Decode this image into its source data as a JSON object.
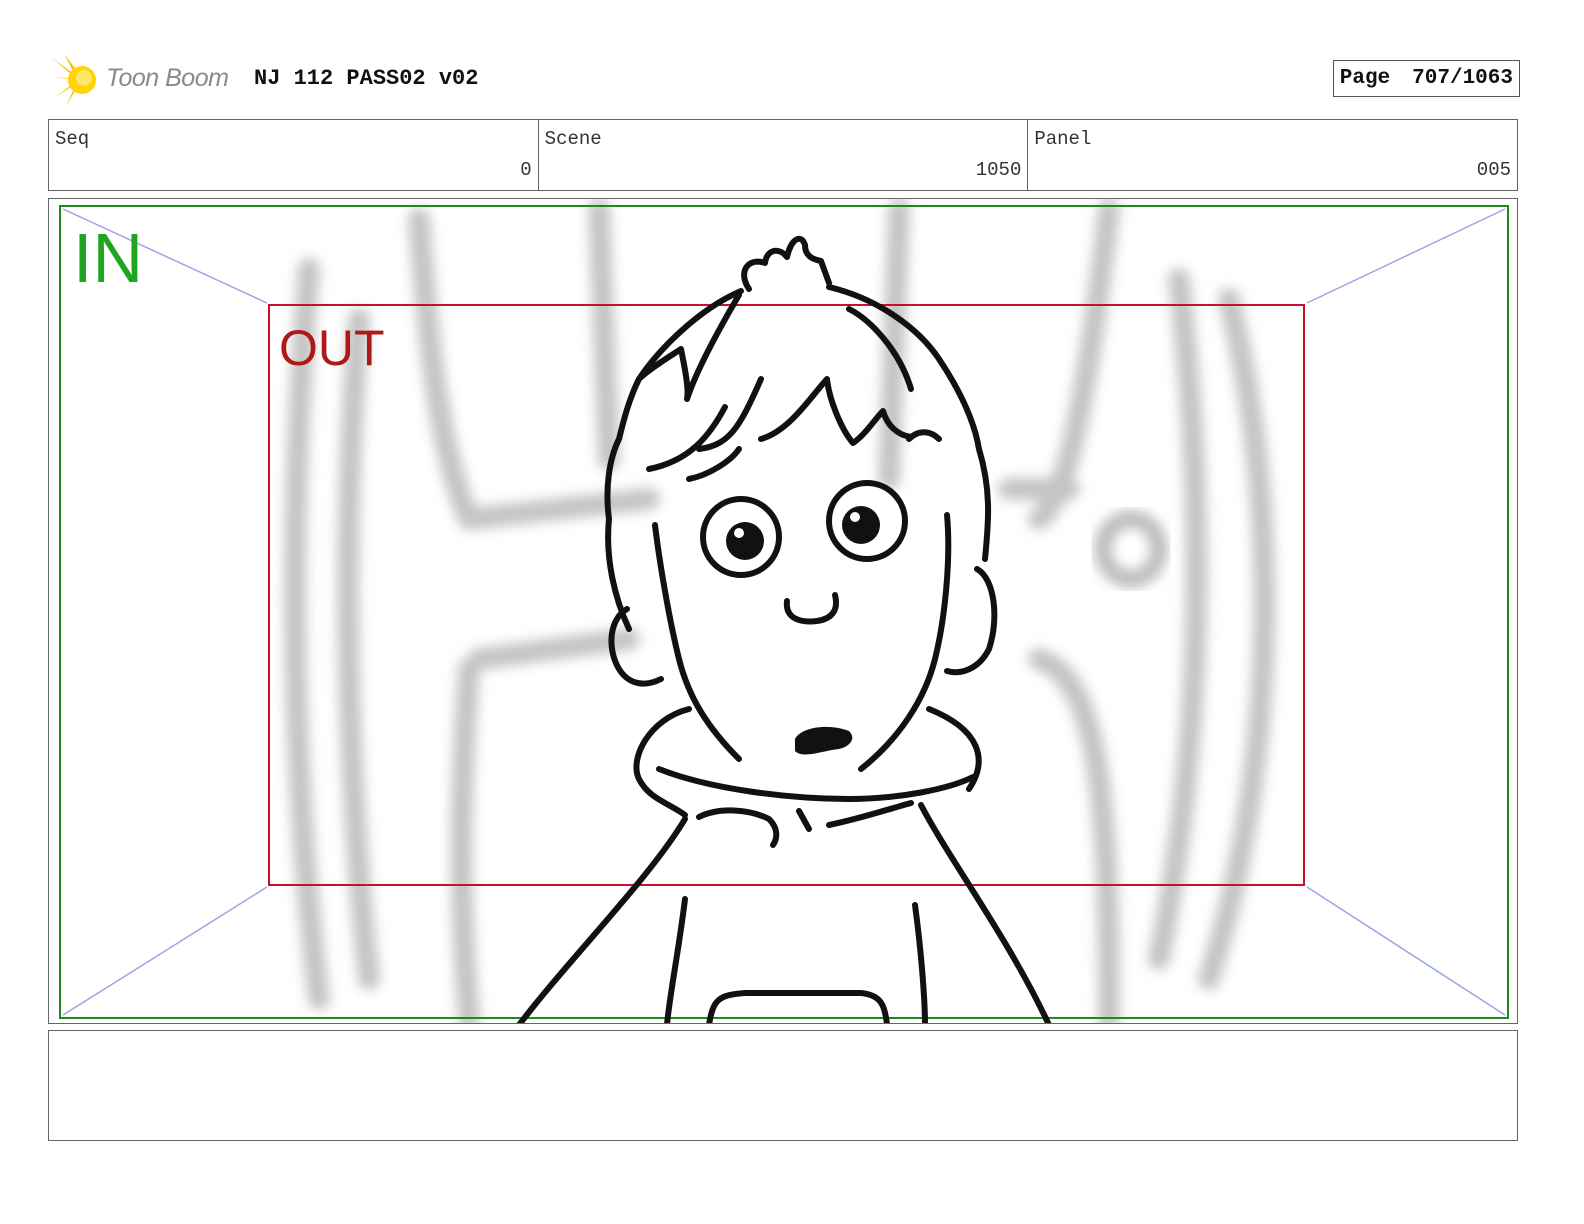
{
  "header": {
    "logo_text": "Toon Boom",
    "doc_title": "NJ 112 PASS02 v02",
    "page_label": "Page",
    "page_number": "707/1063"
  },
  "info": {
    "seq_label": "Seq",
    "seq_value": "0",
    "scene_label": "Scene",
    "scene_value": "1050",
    "panel_label": "Panel",
    "panel_value": "005"
  },
  "frame": {
    "in_label": "IN",
    "out_label": "OUT",
    "in_color": "#1fa51f",
    "out_color": "#b01818"
  },
  "notes": {
    "text": ""
  }
}
